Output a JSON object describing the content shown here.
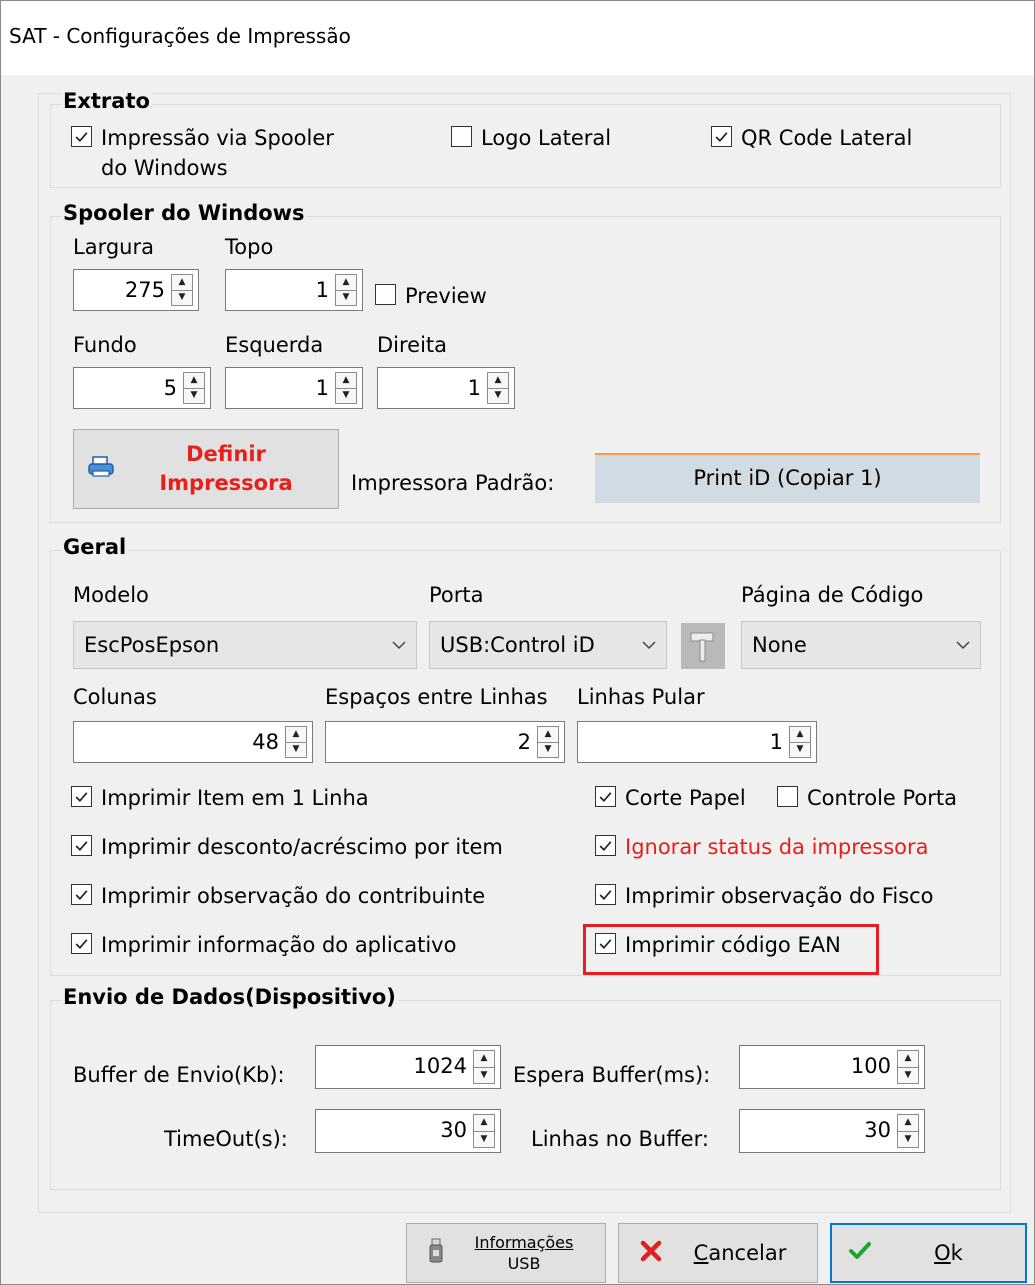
{
  "window": {
    "title": "SAT - Configurações de Impressão"
  },
  "extrato": {
    "legend": "Extrato",
    "spooler_line1": "Impressão via Spooler",
    "spooler_line2": "do Windows",
    "spooler_checked": true,
    "logo_lateral": "Logo Lateral",
    "logo_lateral_checked": false,
    "qr_code_lateral": "QR Code Lateral",
    "qr_code_lateral_checked": true
  },
  "spooler": {
    "legend": "Spooler do Windows",
    "largura_label": "Largura",
    "largura_value": "275",
    "topo_label": "Topo",
    "topo_value": "1",
    "preview_label": "Preview",
    "preview_checked": false,
    "fundo_label": "Fundo",
    "fundo_value": "5",
    "esquerda_label": "Esquerda",
    "esquerda_value": "1",
    "direita_label": "Direita",
    "direita_value": "1",
    "definir_line1": "Definir",
    "definir_line2": "Impressora",
    "impressora_padrao_label": "Impressora Padrão:",
    "impressora_padrao_value": "Print iD (Copiar 1)"
  },
  "geral": {
    "legend": "Geral",
    "modelo_label": "Modelo",
    "modelo_value": "EscPosEpson",
    "porta_label": "Porta",
    "porta_value": "USB:Control iD",
    "pagina_label": "Página de Código",
    "pagina_value": "None",
    "colunas_label": "Colunas",
    "colunas_value": "48",
    "espacos_label": "Espaços entre Linhas",
    "espacos_value": "2",
    "linhas_pular_label": "Linhas Pular",
    "linhas_pular_value": "1",
    "checks": {
      "item_1_linha": "Imprimir Item em 1 Linha",
      "desconto": "Imprimir desconto/acréscimo por item",
      "obs_contribuinte": "Imprimir observação do contribuinte",
      "info_aplicativo": "Imprimir informação do aplicativo",
      "corte_papel": "Corte Papel",
      "controle_porta": "Controle Porta",
      "ignorar_status": "Ignorar status da impressora",
      "obs_fisco": "Imprimir observação do Fisco",
      "codigo_ean": "Imprimir código EAN"
    }
  },
  "envio": {
    "legend": "Envio de Dados(Dispositivo)",
    "buffer_label": "Buffer de Envio(Kb):",
    "buffer_value": "1024",
    "espera_label": "Espera Buffer(ms):",
    "espera_value": "100",
    "timeout_label": "TimeOut(s):",
    "timeout_value": "30",
    "linhas_buffer_label": "Linhas no Buffer:",
    "linhas_buffer_value": "30"
  },
  "buttons": {
    "info_usb_line1": "Informações",
    "info_usb_line2": "USB",
    "cancelar_prefix": "C",
    "cancelar_rest": "ancelar",
    "ok_prefix": "O",
    "ok_rest": "k"
  },
  "colors": {
    "accent_red": "#e8201c",
    "highlight_border": "#e81c24",
    "focus_blue": "#0078d7",
    "status_bar": "#ff9a3c"
  }
}
